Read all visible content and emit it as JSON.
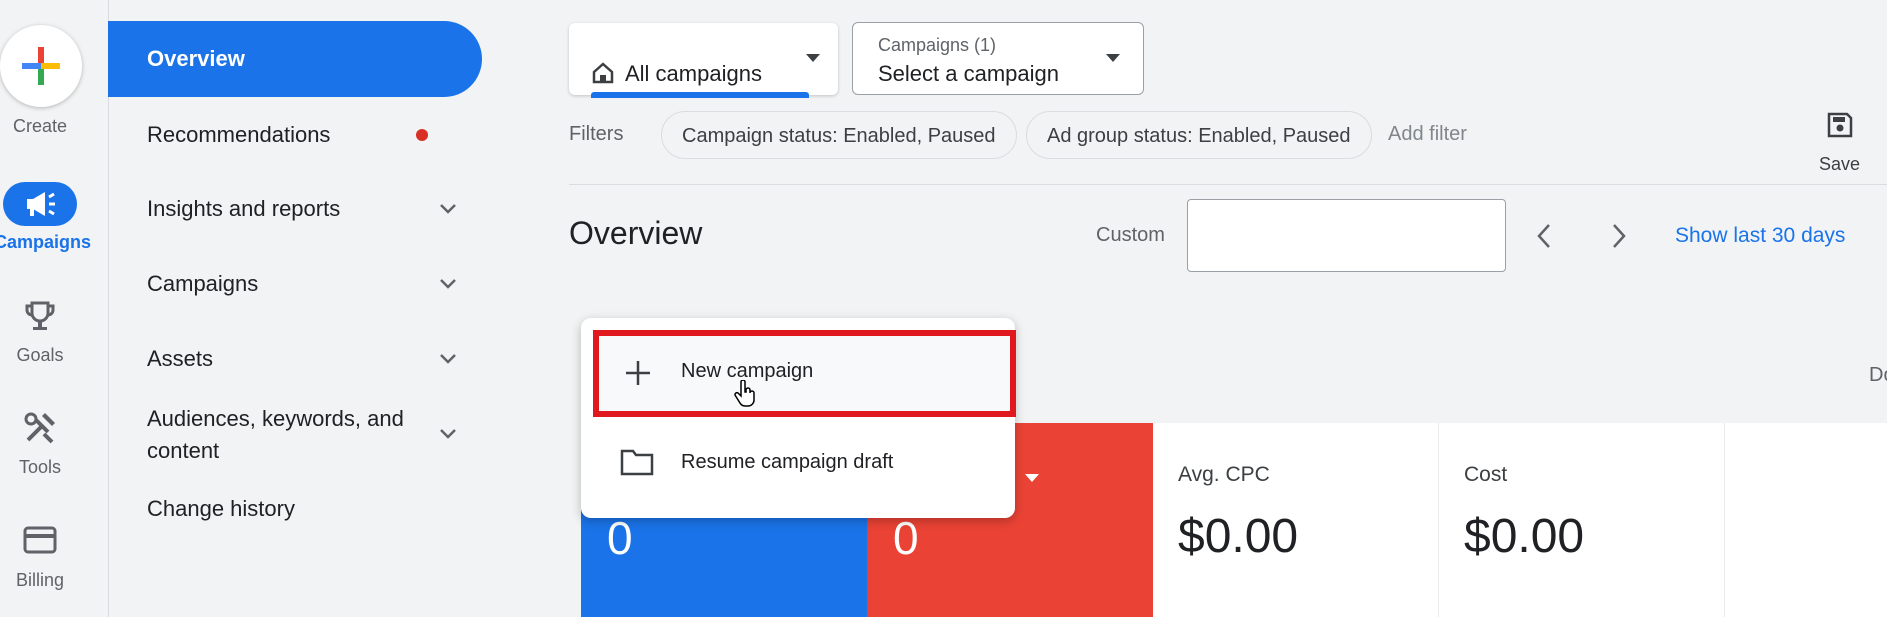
{
  "rail": {
    "create_label": "Create",
    "campaigns_label": "Campaigns",
    "goals_label": "Goals",
    "tools_label": "Tools",
    "billing_label": "Billing"
  },
  "sidebar": {
    "items": [
      {
        "label": "Overview"
      },
      {
        "label": "Recommendations"
      },
      {
        "label": "Insights and reports"
      },
      {
        "label": "Campaigns"
      },
      {
        "label": "Assets"
      },
      {
        "label": "Audiences, keywords, and content"
      },
      {
        "label": "Change history"
      }
    ]
  },
  "scope": {
    "all_campaigns": "All campaigns",
    "campaigns_count_label": "Campaigns (1)",
    "select_campaign": "Select a campaign"
  },
  "filters": {
    "label": "Filters",
    "chip1": "Campaign status: Enabled, Paused",
    "chip2": "Ad group status: Enabled, Paused",
    "add_filter": "Add filter",
    "save": "Save"
  },
  "header": {
    "title": "Overview",
    "custom_label": "Custom",
    "date_value": "",
    "show_last": "Show last 30 days",
    "partial_right": "Do"
  },
  "menu": {
    "new_campaign": "New campaign",
    "resume_draft": "Resume campaign draft"
  },
  "metrics": [
    {
      "label": "",
      "value": "0"
    },
    {
      "label": "",
      "value": "0"
    },
    {
      "label": "Avg. CPC",
      "value": "$0.00"
    },
    {
      "label": "Cost",
      "value": "$0.00"
    }
  ],
  "colors": {
    "accent_blue": "#1a73e8",
    "metric_red": "#ea4335",
    "highlight_red": "#e0191f",
    "notification_dot": "#d93025"
  }
}
